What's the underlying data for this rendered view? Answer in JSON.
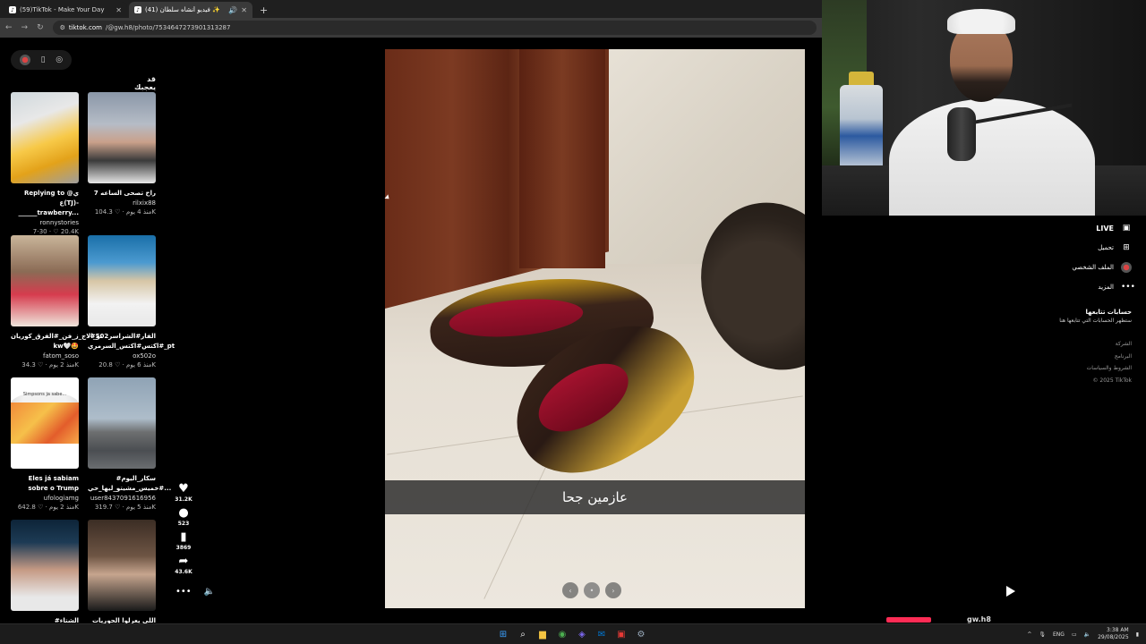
{
  "browser": {
    "tabs": [
      {
        "title": "(59)TikTok - Make Your Day",
        "active": false
      },
      {
        "title": "(41) فيديو أنشأه سلطان ✨",
        "active": true
      }
    ],
    "url_domain": "tiktok.com",
    "url_path": "/@gw.h8/photo/7534647273901313287"
  },
  "sidebar": {
    "section_title": "قد يعجبك",
    "cards": [
      {
        "title": "Replying to @ي ع(TJ)-______trawberry...",
        "user": "ronnystories",
        "meta": "7-30 · ♡ 20.4K"
      },
      {
        "title": "راح تصحى الساعه 7",
        "user": "rilxix88",
        "meta": "منذ 4 يوم · ♡ 104.3K"
      },
      {
        "title": "تو_الاج_ز_فن_#الفرق_كوريان kw🤍🤩",
        "user": "fatom_soso",
        "meta": "منذ 2 يوم · ♡ 34.3K"
      },
      {
        "title": "#الفار#الشراسر502 #اكتس#اكتس_السرمري_pt",
        "user": "ox502o",
        "meta": "منذ 6 يوم · ♡ 20.8K"
      },
      {
        "title": "Eles já sabiam sobre o Trump",
        "user": "ufologiamg",
        "meta": "منذ 2 يوم · ♡ 642.8K"
      },
      {
        "title": "#سكار_اليوم #خميس_مشيتو_ليها_حي...",
        "user": "user8437091616956",
        "meta": "منذ 5 يوم · ♡ 319.7K"
      },
      {
        "title": "#الشتاء",
        "user": "",
        "meta": ""
      },
      {
        "title": "اللي يعرلوا الحوريات كانيه",
        "user": "",
        "meta": ""
      }
    ],
    "card5_caption": "Simpsons ja sabe..."
  },
  "actions": {
    "likes": "31.2K",
    "comments": "523",
    "saves": "3869",
    "shares": "43.6K"
  },
  "photo": {
    "caption": "عازمين جحا"
  },
  "right_menu": {
    "live": "LIVE",
    "upload": "تحميل",
    "profile": "الملف الشخصي",
    "more": "المزيد",
    "following_title": "حسابات تتابعها",
    "following_sub": "ستظهر الحسابات التي تتابعها هنا",
    "links": [
      "الشركة",
      "البرنامج",
      "الشروط والسياسات",
      "© 2025 TikTok"
    ]
  },
  "bottom": {
    "handle": "gw.h8"
  },
  "taskbar": {
    "lang": "ENG",
    "time": "3:38 AM",
    "date": "29/08/2025"
  },
  "colors": {
    "tiktok_red": "#fe2c55",
    "chrome_bg": "#1f1f1f"
  }
}
